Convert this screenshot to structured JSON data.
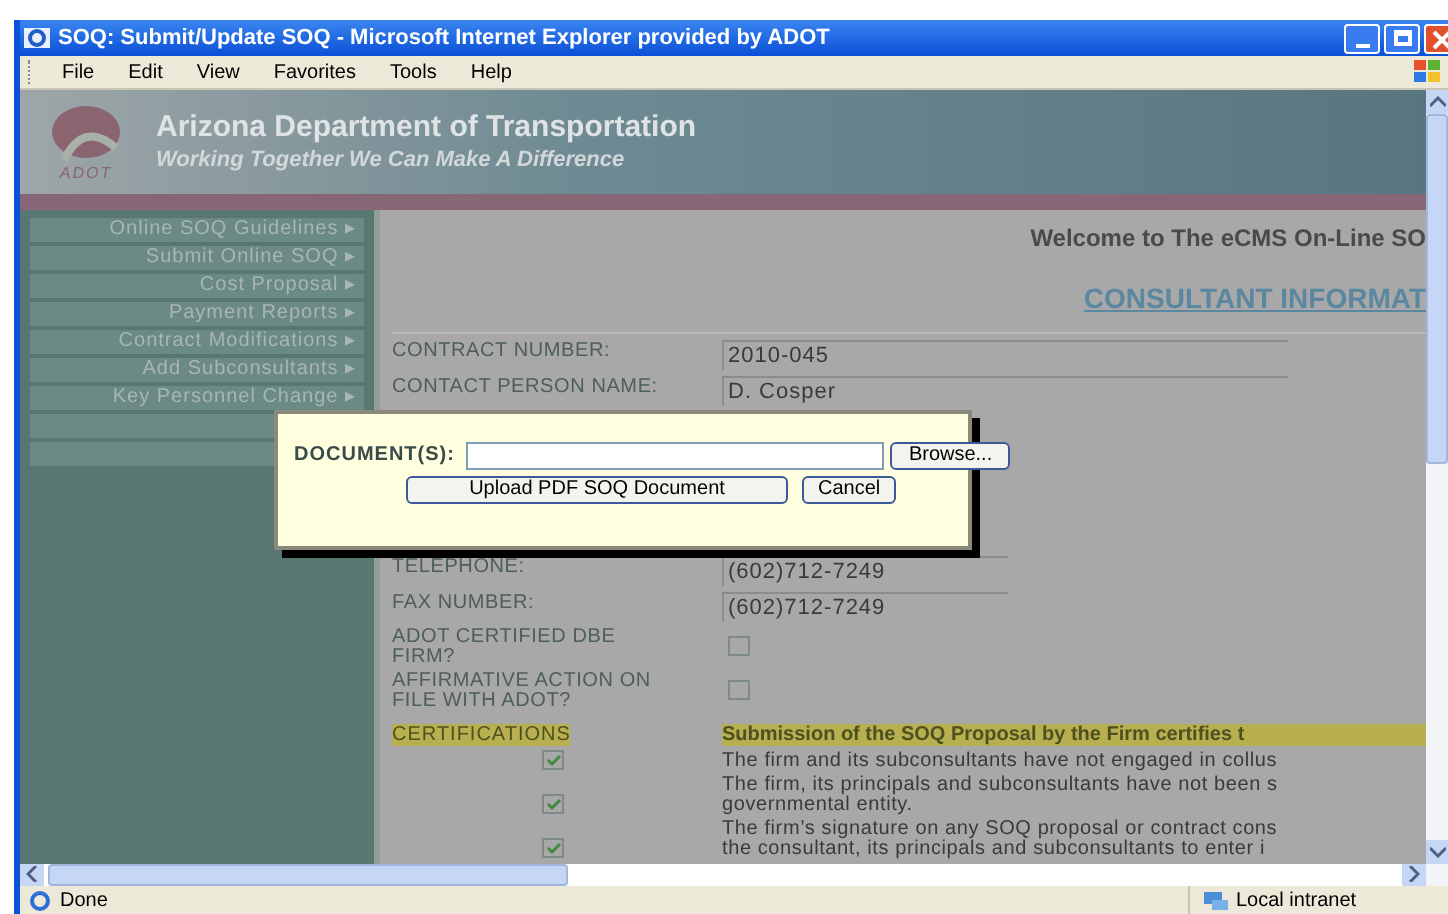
{
  "window": {
    "title": "SOQ: Submit/Update SOQ - Microsoft Internet Explorer provided by ADOT"
  },
  "menu_bar": [
    "File",
    "Edit",
    "View",
    "Favorites",
    "Tools",
    "Help"
  ],
  "header": {
    "logo_text": "ADOT",
    "title": "Arizona Department of Transportation",
    "subtitle": "Working Together We Can Make A Difference"
  },
  "sidebar": {
    "items": [
      {
        "label": "Online SOQ Guidelines ▸"
      },
      {
        "label": "Submit Online SOQ ▸"
      },
      {
        "label": "Cost Proposal ▸"
      },
      {
        "label": "Payment Reports ▸"
      },
      {
        "label": "Contract Modifications ▸"
      },
      {
        "label": "Add Subconsultants ▸"
      },
      {
        "label": "Key Personnel Change ▸"
      }
    ]
  },
  "content": {
    "welcome": "Welcome to The eCMS On-Line SO",
    "heading": "CONSULTANT INFORMAT",
    "fields": [
      {
        "kind": "text",
        "label": "CONTRACT NUMBER:",
        "value": "2010-045"
      },
      {
        "kind": "text",
        "label": "CONTACT PERSON NAME:",
        "value": "D. Cosper"
      },
      {
        "kind": "hidden"
      },
      {
        "kind": "hidden"
      },
      {
        "kind": "hidden"
      },
      {
        "kind": "hidden"
      },
      {
        "kind": "text",
        "label": "TELEPHONE:",
        "value": "(602)712-7249"
      },
      {
        "kind": "text",
        "label": "FAX NUMBER:",
        "value": "(602)712-7249"
      },
      {
        "kind": "check",
        "label": "ADOT CERTIFIED DBE FIRM?",
        "checked": false
      },
      {
        "kind": "check",
        "label": "AFFIRMATIVE ACTION ON FILE WITH ADOT?",
        "checked": false
      }
    ],
    "certifications": {
      "label": "CERTIFICATIONS",
      "text": "Submission of the SOQ Proposal by the Firm certifies t",
      "items": [
        {
          "checked": true,
          "lines": [
            "The firm and its subconsultants have not engaged in collus"
          ]
        },
        {
          "checked": true,
          "lines": [
            "The firm, its principals and subconsultants have not been s",
            "governmental entity."
          ]
        },
        {
          "checked": true,
          "lines": [
            "The firm’s signature on any SOQ proposal or contract cons",
            "the consultant, its principals and subconsultants to enter i"
          ]
        }
      ]
    }
  },
  "dialog": {
    "label": "DOCUMENT(S):",
    "browse": "Browse...",
    "upload": "Upload PDF SOQ Document",
    "cancel": "Cancel"
  },
  "status_bar": {
    "text": "Done",
    "zone": "Local intranet"
  }
}
